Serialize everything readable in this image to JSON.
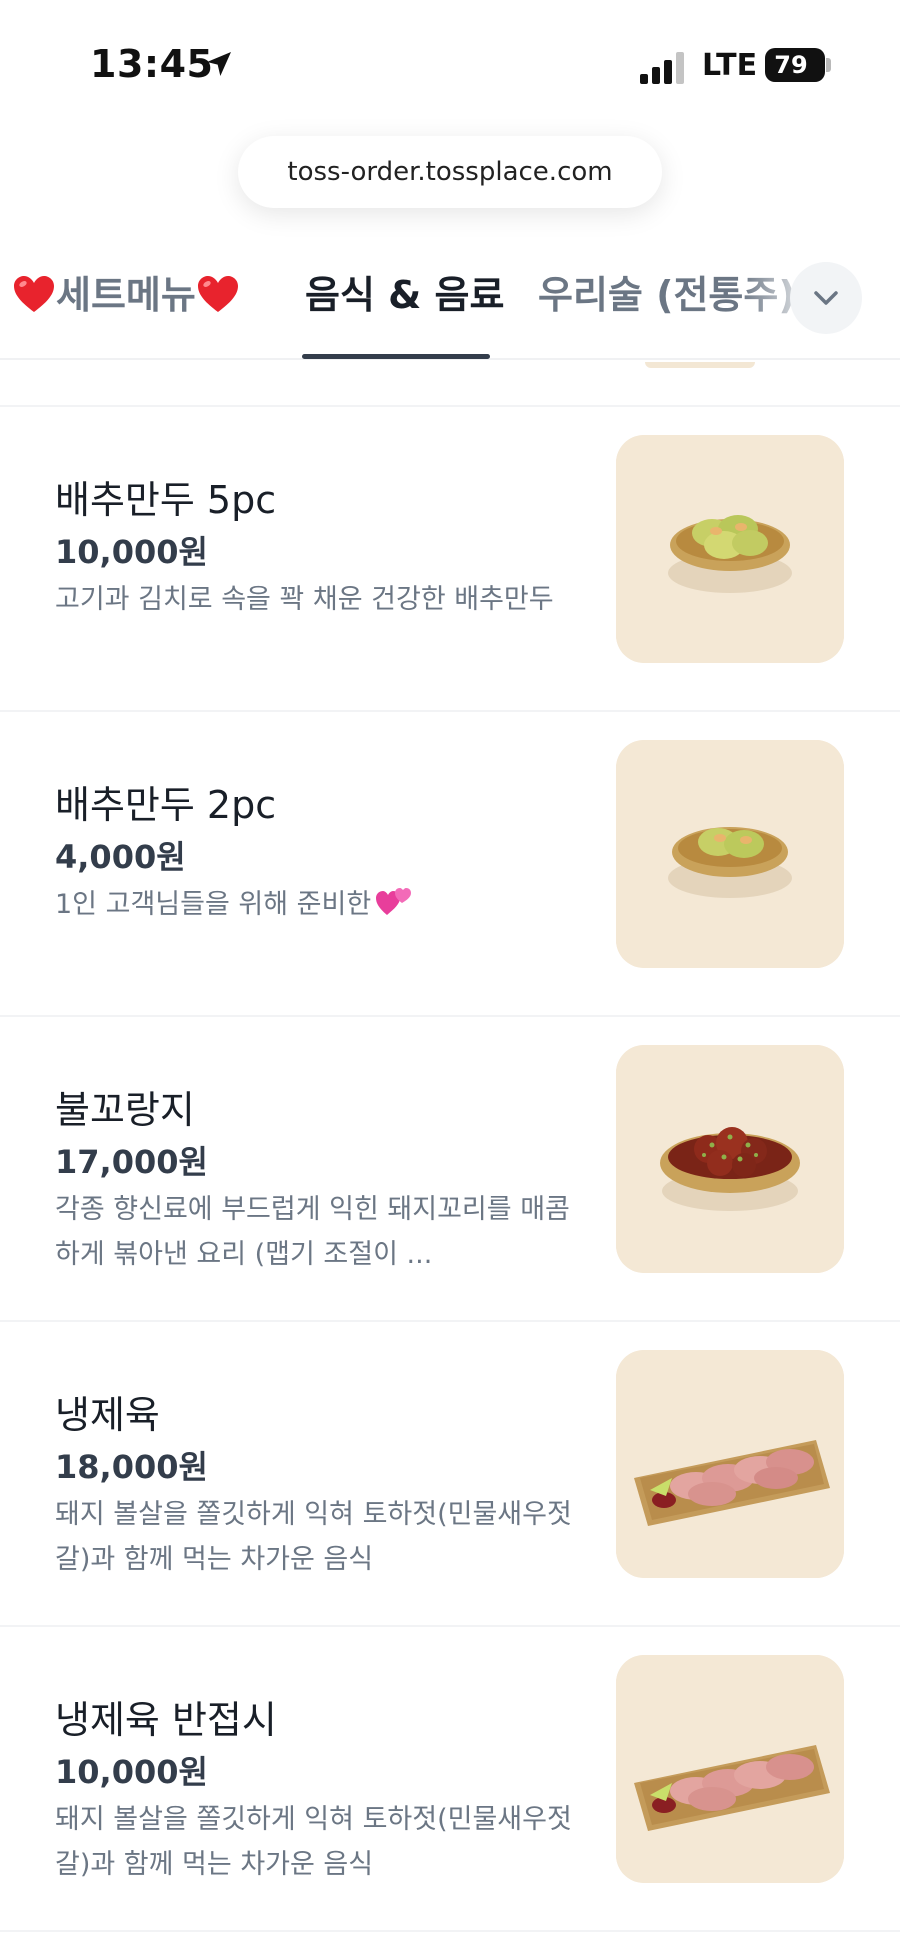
{
  "status_bar": {
    "time": "13:45",
    "network": "LTE",
    "battery": "79"
  },
  "browser": {
    "url": "toss-order.tossplace.com"
  },
  "tabs": [
    {
      "label": "세트메뉴",
      "active": false
    },
    {
      "label": "음식 & 음료",
      "active": true
    },
    {
      "label": "우리술 (전통주)",
      "active": false
    }
  ],
  "menu_items": [
    {
      "name": "배추만두 5pc",
      "price": "10,000원",
      "description": "고기과 김치로 속을 꽉 채운 건강한 배추만두",
      "photo": "dumpling"
    },
    {
      "name": "배추만두 2pc",
      "price": "4,000원",
      "description": "1인 고객님들을 위해 준비한",
      "photo": "dumpling-small"
    },
    {
      "name": "불꼬랑지",
      "price": "17,000원",
      "description": "각종 향신료에 부드럽게 익힌 돼지꼬리를 매콤하게 볶아낸 요리 (맵기 조절이 ...",
      "photo": "spicy-pork-tail"
    },
    {
      "name": "냉제육",
      "price": "18,000원",
      "description": "돼지 볼살을 쫄깃하게 익혀 토하젓(민물새우젓갈)과 함께 먹는 차가운 음식",
      "photo": "cold-pork-platter"
    },
    {
      "name": "냉제육 반접시",
      "price": "10,000원",
      "description": "돼지 볼살을 쫄깃하게 익혀 토하젓(민물새우젓갈)과 함께 먹는 차가운 음식",
      "photo": "cold-pork-platter"
    }
  ],
  "colors": {
    "text_primary": "#191f28",
    "text_secondary": "#6b7684",
    "tab_indicator": "#333d4b",
    "photo_background": "#f4e8d5"
  },
  "icons": [
    "location-arrow-icon",
    "signal-icon",
    "battery-icon",
    "heart-icon",
    "chevron-down-icon",
    "two-hearts-icon"
  ]
}
